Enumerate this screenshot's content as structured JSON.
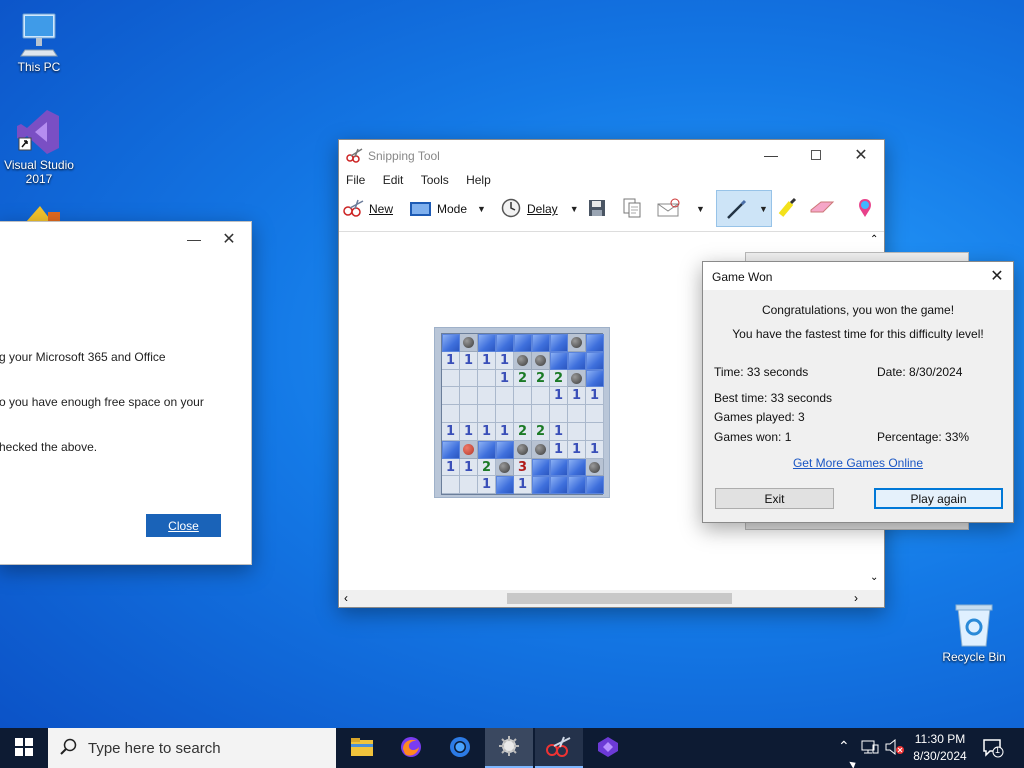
{
  "desktop": {
    "icons": [
      {
        "label": "This PC"
      },
      {
        "label": "Visual Studio 2017"
      },
      {
        "label": "Recycle Bin"
      }
    ]
  },
  "left_dialog": {
    "lines": [
      "g your Microsoft 365 and Office",
      "o you have enough free space on your",
      "hecked the above."
    ],
    "close_label": "Close",
    "accent": "#1a63b8"
  },
  "snipping_tool": {
    "title": "Snipping Tool",
    "menu": [
      "File",
      "Edit",
      "Tools",
      "Help"
    ],
    "toolbar": {
      "new_label": "New",
      "mode_label": "Mode",
      "delay_label": "Delay"
    }
  },
  "minesweeper": {
    "rows": [
      [
        "h",
        "m",
        "h",
        "h",
        "h",
        "h",
        "h",
        "m",
        "h"
      ],
      [
        "1",
        "1",
        "1",
        "1",
        "m",
        "m",
        "h",
        "h",
        "h"
      ],
      [
        "",
        "",
        "",
        "1",
        "2",
        "2",
        "2",
        "m",
        "h"
      ],
      [
        "",
        "",
        "",
        "",
        "",
        "",
        "1",
        "1",
        "1"
      ],
      [
        "",
        "",
        "",
        "",
        "",
        "",
        "",
        "",
        ""
      ],
      [
        "1",
        "1",
        "1",
        "1",
        "2",
        "2",
        "1",
        "",
        ""
      ],
      [
        "h",
        "x",
        "h",
        "h",
        "m",
        "m",
        "1",
        "1",
        "1"
      ],
      [
        "1",
        "1",
        "2",
        "m",
        "3",
        "h",
        "h",
        "h",
        "m"
      ],
      [
        "",
        "",
        "1",
        "h",
        "1",
        "h",
        "h",
        "h",
        "h"
      ]
    ]
  },
  "game_won": {
    "title": "Game Won",
    "congrats": "Congratulations, you won the game!",
    "fastest": "You have the fastest time for this difficulty level!",
    "time": "Time: 33 seconds",
    "date": "Date: 8/30/2024",
    "best_time": "Best time: 33 seconds",
    "games_played": "Games played: 3",
    "games_won": "Games won: 1",
    "percentage": "Percentage: 33%",
    "more_games": "Get More Games Online",
    "exit_label": "Exit",
    "play_again_label": "Play again",
    "link_color": "#1a56c4"
  },
  "taskbar": {
    "search_placeholder": "Type here to search",
    "clock_time": "11:30 PM",
    "clock_date": "8/30/2024",
    "notification_count": "1"
  }
}
